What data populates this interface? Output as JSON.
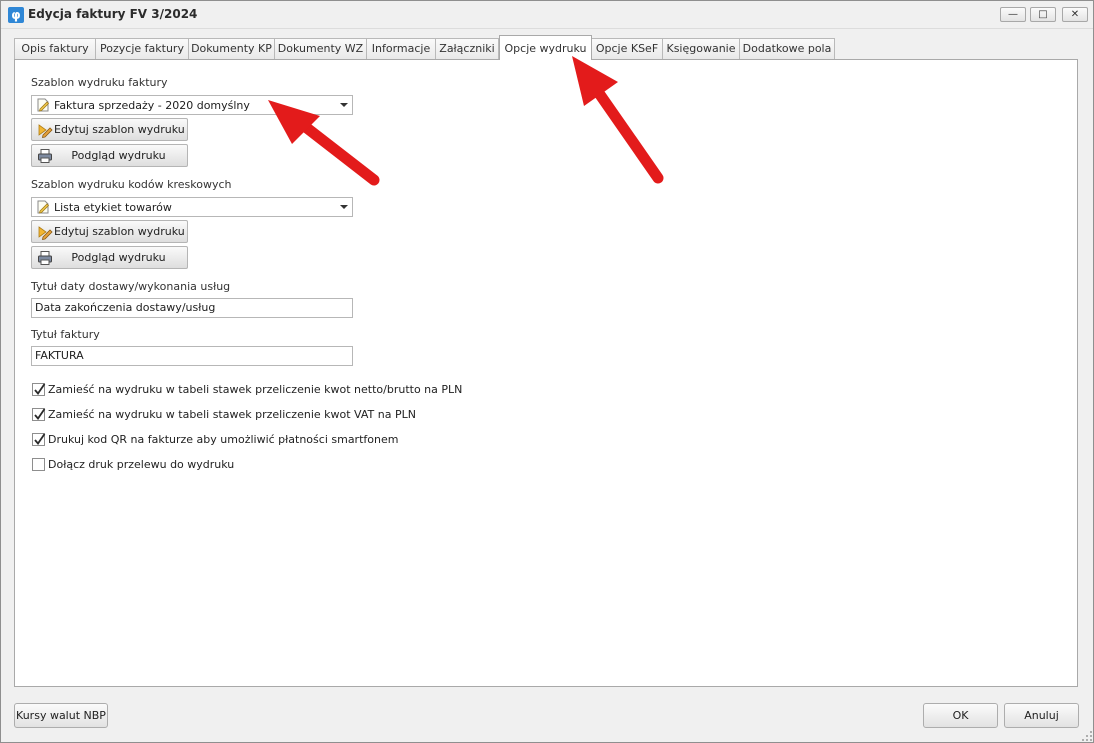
{
  "window": {
    "title": "Edycja faktury FV 3/2024",
    "icon": "app-logo-icon",
    "controls": {
      "minimize": "—",
      "maximize": "□",
      "close": "✕"
    }
  },
  "tabs": [
    {
      "label": "Opis faktury"
    },
    {
      "label": "Pozycje faktury"
    },
    {
      "label": "Dokumenty KP"
    },
    {
      "label": "Dokumenty WZ"
    },
    {
      "label": "Informacje"
    },
    {
      "label": "Załączniki"
    },
    {
      "label": "Opcje wydruku",
      "active": true
    },
    {
      "label": "Opcje KSeF"
    },
    {
      "label": "Księgowanie"
    },
    {
      "label": "Dodatkowe pola"
    }
  ],
  "invoice_print": {
    "label": "Szablon wydruku faktury",
    "template_value": "Faktura sprzedaży - 2020 domyślny",
    "edit_button": "Edytuj szablon wydruku",
    "preview_button": "Podgląd wydruku"
  },
  "barcode_print": {
    "label": "Szablon wydruku kodów kreskowych",
    "template_value": "Lista etykiet towarów",
    "edit_button": "Edytuj szablon wydruku",
    "preview_button": "Podgląd wydruku"
  },
  "delivery_date_title": {
    "label": "Tytuł daty dostawy/wykonania usług",
    "value": "Data zakończenia dostawy/usług"
  },
  "invoice_title": {
    "label": "Tytuł faktury",
    "value": "FAKTURA"
  },
  "checkboxes": [
    {
      "label": "Zamieść na wydruku w tabeli stawek przeliczenie kwot netto/brutto na PLN",
      "checked": true
    },
    {
      "label": "Zamieść na wydruku w tabeli stawek przeliczenie kwot VAT na PLN",
      "checked": true
    },
    {
      "label": "Drukuj kod QR na fakturze aby umożliwić płatności smartfonem",
      "checked": true
    },
    {
      "label": "Dołącz druk przelewu do wydruku",
      "checked": false
    }
  ],
  "footer": {
    "nbp_button": "Kursy walut NBP",
    "ok_button": "OK",
    "cancel_button": "Anuluj"
  },
  "colors": {
    "annotation_arrow": "#e31b1b",
    "app_icon": "#2f87d6"
  }
}
